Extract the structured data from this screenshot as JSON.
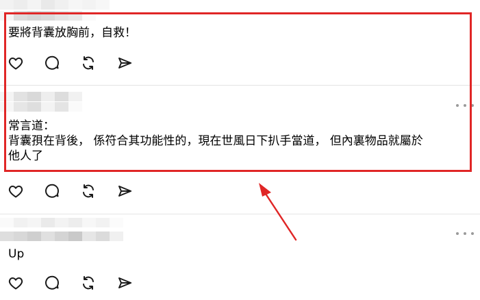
{
  "posts": [
    {
      "text_lines": [
        "要將背囊放胸前，自救！"
      ]
    },
    {
      "text_lines": [
        "常言道：",
        "背囊孭在背後， 係符合其功能性的，現在世風日下扒手當道， 但內裏物品就屬於",
        "他人了"
      ]
    },
    {
      "text_lines": [
        "Up"
      ]
    }
  ],
  "icons": {
    "like": "heart-icon",
    "comment": "comment-bubble-icon",
    "repost": "repost-icon",
    "share": "send-icon",
    "more": "more-horizontal-icon"
  },
  "colors": {
    "highlight": "#e02626",
    "divider": "#e4e4e4",
    "icon": "#1a1a1a",
    "more_dots": "#9a9a9a"
  }
}
